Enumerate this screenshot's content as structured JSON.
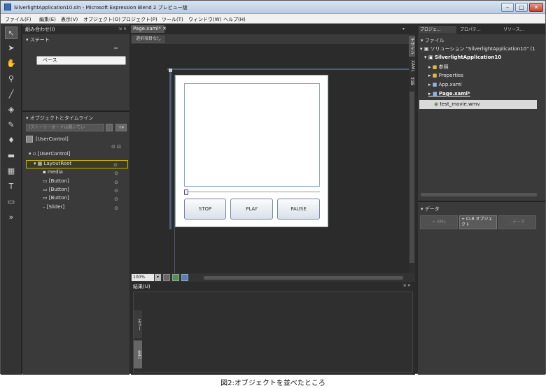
{
  "window": {
    "title": "SilverlightApplication10.sln - Microsoft Expression Blend 2 プレビュー版"
  },
  "menu": [
    "ファイル(F)",
    "編集(E)",
    "表示(V)",
    "オブジェクト(O)",
    "プロジェクト(P)",
    "ツール(T)",
    "ウィンドウ(W)",
    "ヘルプ(H)"
  ],
  "left_panel": {
    "title": "組み合わせ(I)",
    "states_header": "ステート",
    "base_state": "ベース",
    "timeline_header": "オブジェクトとタイムライン",
    "storyboard_placeholder": "(ストーリーボードは開いてい",
    "usercontrol_scope": "[UserControl]",
    "tree": [
      {
        "label": "[UserControl]",
        "indent": 0
      },
      {
        "label": "LayoutRoot",
        "indent": 1
      },
      {
        "label": "media",
        "indent": 2
      },
      {
        "label": "[Button]",
        "indent": 2
      },
      {
        "label": "[Button]",
        "indent": 2
      },
      {
        "label": "[Button]",
        "indent": 2
      },
      {
        "label": "[Slider]",
        "indent": 2
      }
    ]
  },
  "document": {
    "tab": "Page.xaml*",
    "breadcrumb": "選択項目なし",
    "side_tabs": [
      "デザイン",
      "XAML",
      "分割"
    ],
    "zoom": "100%",
    "buttons": [
      "STOP",
      "PLAY",
      "PAUSE"
    ]
  },
  "results": {
    "title": "結果(U)",
    "side_tabs": [
      "エラー",
      "出力"
    ]
  },
  "right_panel": {
    "tabs": [
      "プロジェ...",
      "プロパテ...",
      "リソース..."
    ],
    "files_header": "ファイル",
    "files": [
      {
        "label": "ソリューション \"SilverlightApplication10\" (1",
        "indent": 0,
        "bold": false
      },
      {
        "label": "SilverlightApplication10",
        "indent": 1,
        "bold": true
      },
      {
        "label": "参照",
        "indent": 2,
        "bold": false
      },
      {
        "label": "Properties",
        "indent": 2,
        "bold": false
      },
      {
        "label": "App.xaml",
        "indent": 2,
        "bold": false
      },
      {
        "label": "Page.xaml*",
        "indent": 2,
        "bold": true
      },
      {
        "label": "test_movie.wmv",
        "indent": 2,
        "bold": false
      }
    ],
    "data_header": "データ",
    "data_buttons": [
      "+ XML",
      "+ CLR オブジェクト",
      "- データ"
    ]
  },
  "caption": "図2:オブジェクトを並べたところ"
}
